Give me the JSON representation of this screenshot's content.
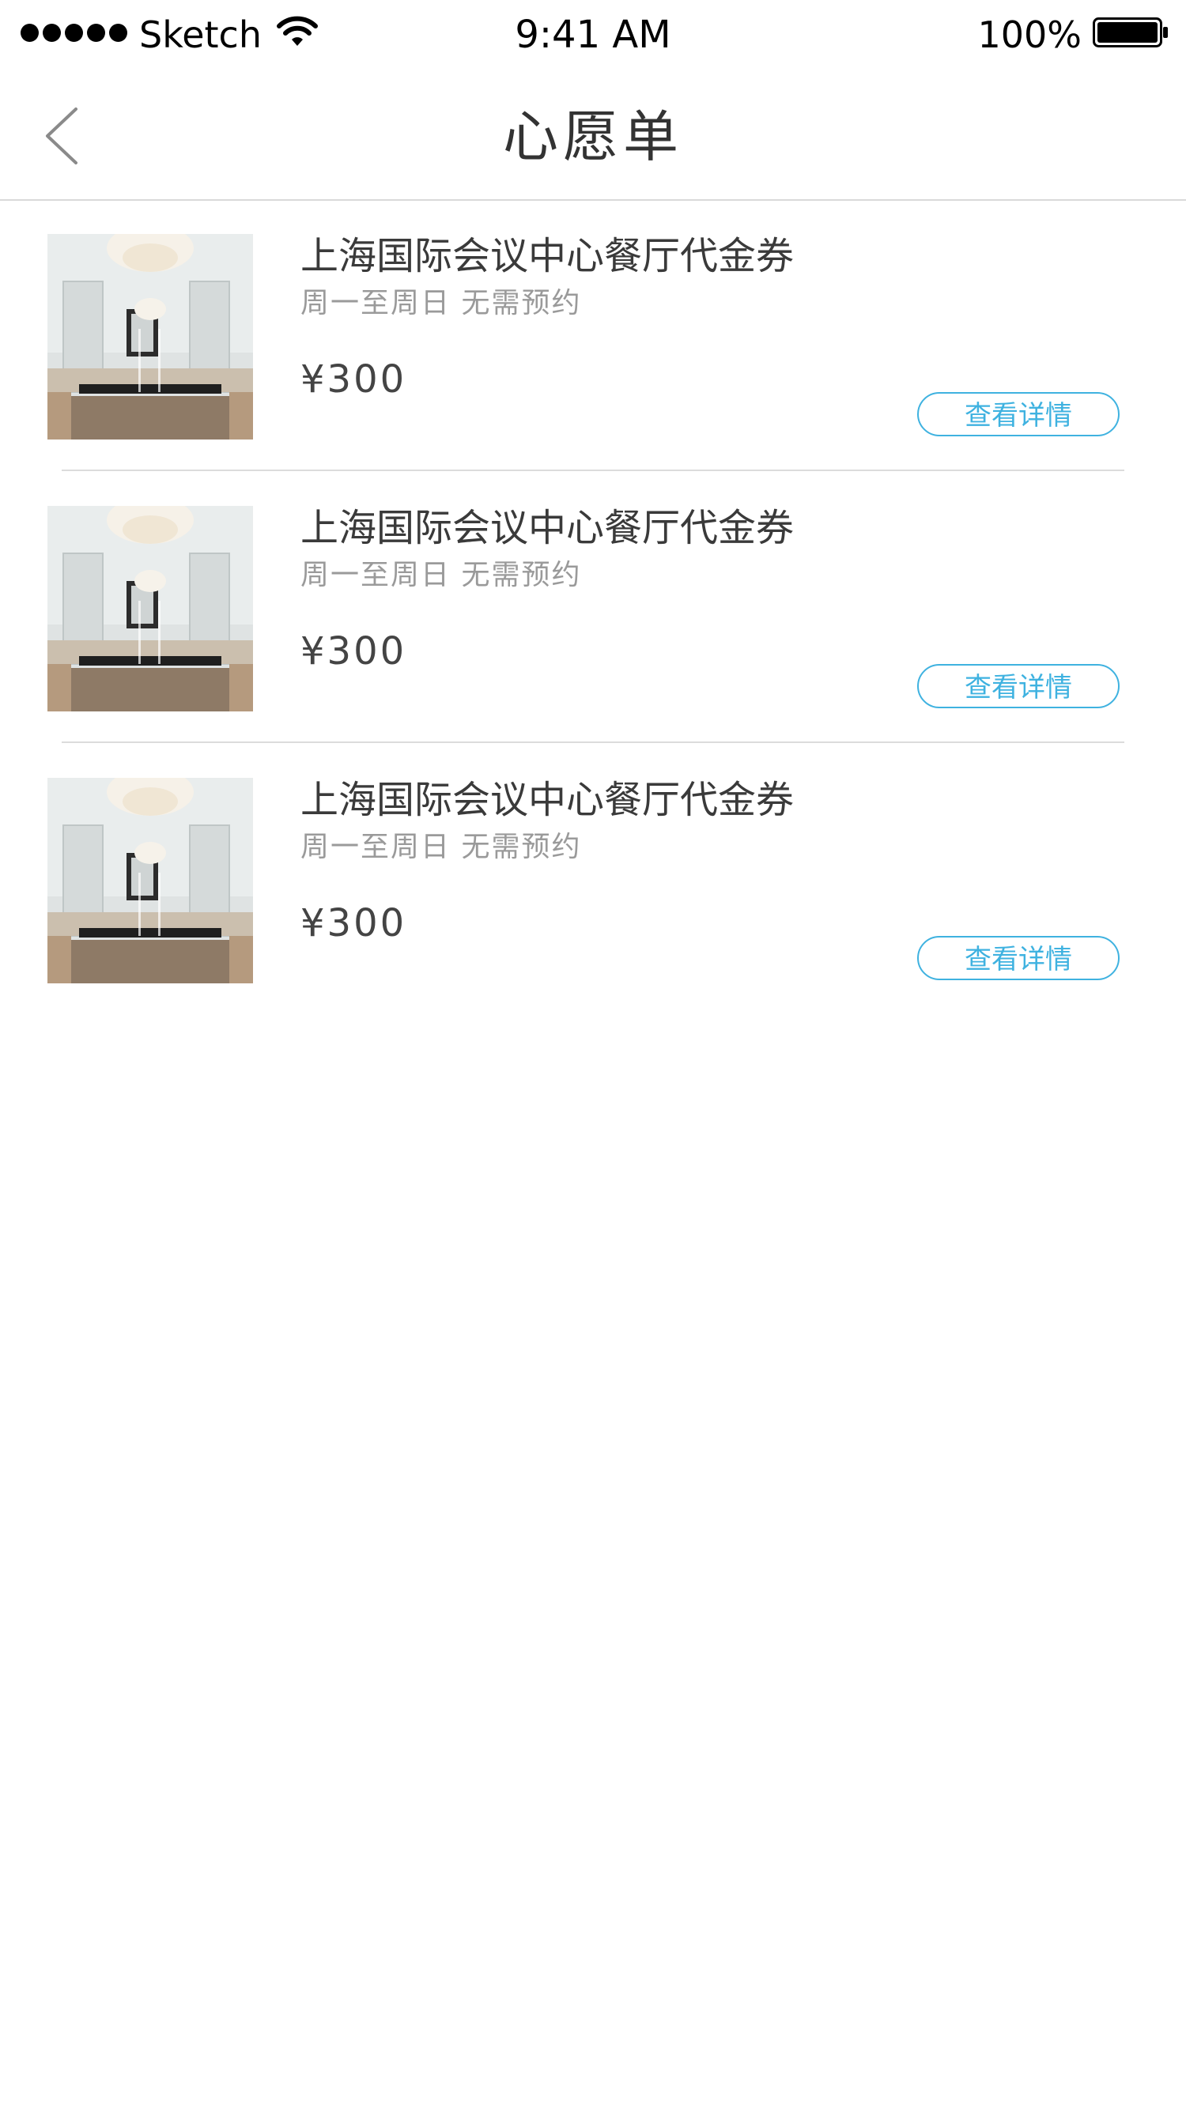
{
  "status_bar": {
    "carrier": "Sketch",
    "time": "9:41 AM",
    "battery": "100%"
  },
  "nav": {
    "title": "心愿单",
    "back_icon": "chevron-left-icon"
  },
  "items": [
    {
      "title": "上海国际会议中心餐厅代金券",
      "subtitle": "周一至周日 无需预约",
      "price": "¥300",
      "button": "查看详情"
    },
    {
      "title": "上海国际会议中心餐厅代金券",
      "subtitle": "周一至周日 无需预约",
      "price": "¥300",
      "button": "查看详情"
    },
    {
      "title": "上海国际会议中心餐厅代金券",
      "subtitle": "周一至周日 无需预约",
      "price": "¥300",
      "button": "查看详情"
    }
  ],
  "colors": {
    "accent": "#3fb2e0",
    "divider": "#dcdcdc"
  }
}
